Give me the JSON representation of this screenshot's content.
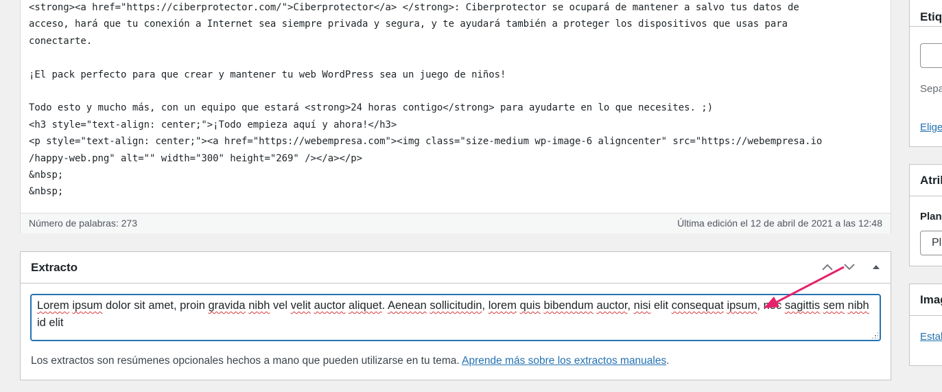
{
  "editor": {
    "code_lines": [
      "<strong><a href=\"https://ciberprotector.com/\">Ciberprotector</a> </strong>: Ciberprotector se ocupará de mantener a salvo tus datos de",
      "acceso, hará que tu conexión a Internet sea siempre privada y segura, y te ayudará también a proteger los dispositivos que usas para",
      "conectarte.",
      "",
      "¡El pack perfecto para que crear y mantener tu web WordPress sea un juego de niños!",
      "",
      "Todo esto y mucho más, con un equipo que estará <strong>24 horas contigo</strong> para ayudarte en lo que necesites. ;)",
      "<h3 style=\"text-align: center;\">¡Todo empieza aquí y ahora!</h3>",
      "<p style=\"text-align: center;\"><a href=\"https://webempresa.com\"><img class=\"size-medium wp-image-6 aligncenter\" src=\"https://webempresa.io",
      "/happy-web.png\" alt=\"\" width=\"300\" height=\"269\" /></a></p>",
      "&nbsp;",
      "&nbsp;"
    ],
    "word_count": "Número de palabras: 273",
    "last_edit": "Última edición el 12 de abril de 2021 a las 12:48"
  },
  "excerpt": {
    "title": "Extracto",
    "text_parts": [
      "Lorem",
      " ",
      "ipsum",
      " dolor sit amet, proin ",
      "gravida",
      " ",
      "nibh",
      " vel ",
      "velit",
      " ",
      "auctor",
      " ",
      "aliquet",
      ". ",
      "Aenean",
      " ",
      "sollicitudin",
      ", ",
      "lorem",
      " ",
      "quis",
      " ",
      "bibendum",
      " ",
      "auctor",
      ", ",
      "nisi",
      " elit ",
      "consequat",
      " ",
      "ipsum",
      ", nec ",
      "sagittis",
      " ",
      "sem",
      " ",
      "nibh",
      " id elit"
    ],
    "help_text": "Los extractos son resúmenes opcionales hechos a mano que pueden utilizarse en tu tema. ",
    "help_link": "Aprende más sobre los extractos manuales",
    "help_end": "."
  },
  "sidebar": {
    "tags_title": "Etiq",
    "tags_separator_text": "Sepa",
    "tags_choose_link": "Elige",
    "attributes_title": "Atrib",
    "template_label": "Plan",
    "template_value": "Pl",
    "image_title": "Imag",
    "image_link": "Estab"
  },
  "colors": {
    "accent": "#2271b1",
    "arrow": "#e5226b",
    "spellcheck": "#d63638"
  },
  "icons": [
    "chevron-up-icon",
    "chevron-down-icon",
    "collapse-triangle-icon",
    "resize-grip-icon"
  ]
}
